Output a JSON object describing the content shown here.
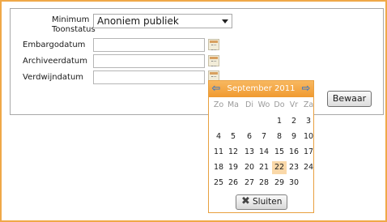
{
  "form": {
    "min_label_line1": "Minimum",
    "min_label_line2": "Toonstatus",
    "min_value": "Anoniem publiek",
    "embargo_label": "Embargodatum",
    "archief_label": "Archiveerdatum",
    "verdwijn_label": "Verdwijndatum",
    "save_label": "Bewaar"
  },
  "calendar": {
    "month_title": "September 2011",
    "weekdays": [
      "Zo",
      "Ma",
      "Di",
      "Wo",
      "Do",
      "Vr",
      "Za"
    ],
    "weeks": [
      [
        "",
        "",
        "",
        "",
        "1",
        "2",
        "3"
      ],
      [
        "4",
        "5",
        "6",
        "7",
        "8",
        "9",
        "10"
      ],
      [
        "11",
        "12",
        "13",
        "14",
        "15",
        "16",
        "17"
      ],
      [
        "18",
        "19",
        "20",
        "21",
        "22",
        "23",
        "24"
      ],
      [
        "25",
        "26",
        "27",
        "28",
        "29",
        "30",
        ""
      ]
    ],
    "selected_day": "22",
    "close_label": "Sluiten",
    "selected_color": "#fad8a8",
    "header_color": "#f09a30"
  }
}
